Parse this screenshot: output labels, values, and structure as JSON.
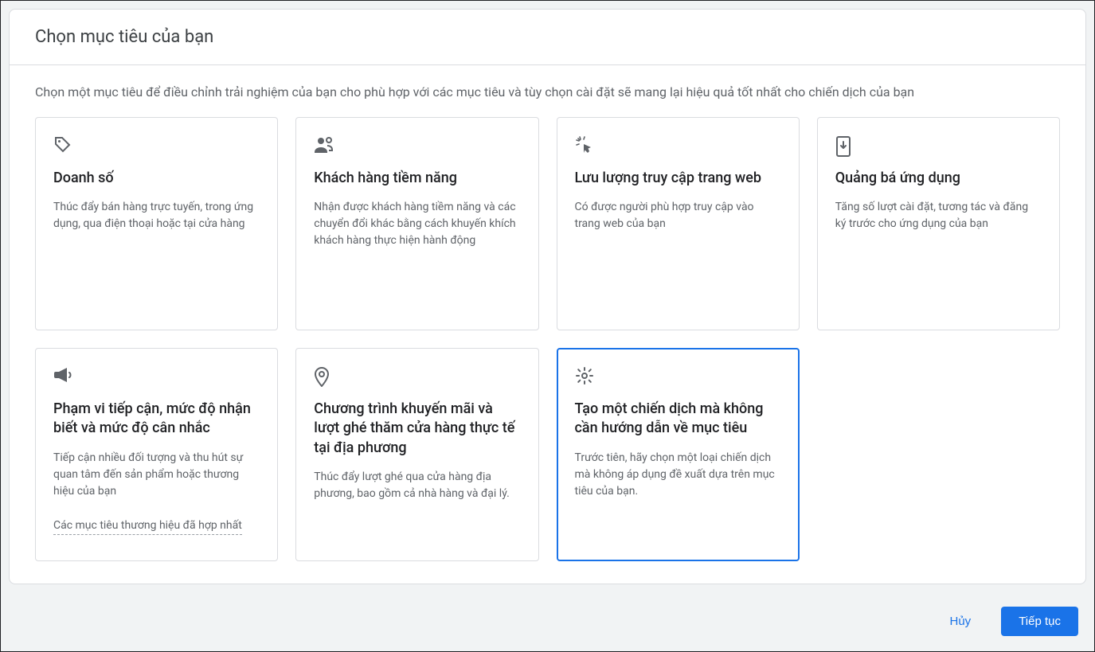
{
  "header": "Chọn mục tiêu của bạn",
  "subtitle": "Chọn một mục tiêu để điều chỉnh trải nghiệm của bạn cho phù hợp với các mục tiêu và tùy chọn cài đặt sẽ mang lại hiệu quả tốt nhất cho chiến dịch của bạn",
  "goals": [
    {
      "icon": "tag-icon",
      "title": "Doanh số",
      "desc": "Thúc đẩy bán hàng trực tuyến, trong ứng dụng, qua điện thoại hoặc tại cửa hàng",
      "extra": ""
    },
    {
      "icon": "people-icon",
      "title": "Khách hàng tiềm năng",
      "desc": "Nhận được khách hàng tiềm năng và các chuyển đổi khác bằng cách khuyến khích khách hàng thực hiện hành động",
      "extra": ""
    },
    {
      "icon": "cursor-click-icon",
      "title": "Lưu lượng truy cập trang web",
      "desc": "Có được người phù hợp truy cập vào trang web của bạn",
      "extra": ""
    },
    {
      "icon": "app-download-icon",
      "title": "Quảng bá ứng dụng",
      "desc": "Tăng số lượt cài đặt, tương tác và đăng ký trước cho ứng dụng của bạn",
      "extra": ""
    },
    {
      "icon": "megaphone-icon",
      "title": "Phạm vi tiếp cận, mức độ nhận biết và mức độ cân nhắc",
      "desc": "Tiếp cận nhiều đối tượng và thu hút sự quan tâm đến sản phẩm hoặc thương hiệu của bạn",
      "extra": "Các mục tiêu thương hiệu đã hợp nhất"
    },
    {
      "icon": "pin-icon",
      "title": "Chương trình khuyến mãi và lượt ghé thăm cửa hàng thực tế tại địa phương",
      "desc": "Thúc đẩy lượt ghé qua cửa hàng địa phương, bao gồm cả nhà hàng và đại lý.",
      "extra": ""
    },
    {
      "icon": "gear-icon",
      "title": "Tạo một chiến dịch mà không cần hướng dẫn về mục tiêu",
      "desc": "Trước tiên, hãy chọn một loại chiến dịch mà không áp dụng đề xuất dựa trên mục tiêu của bạn.",
      "extra": ""
    }
  ],
  "selectedIndex": 6,
  "footer": {
    "cancel": "Hủy",
    "continue": "Tiếp tục"
  }
}
